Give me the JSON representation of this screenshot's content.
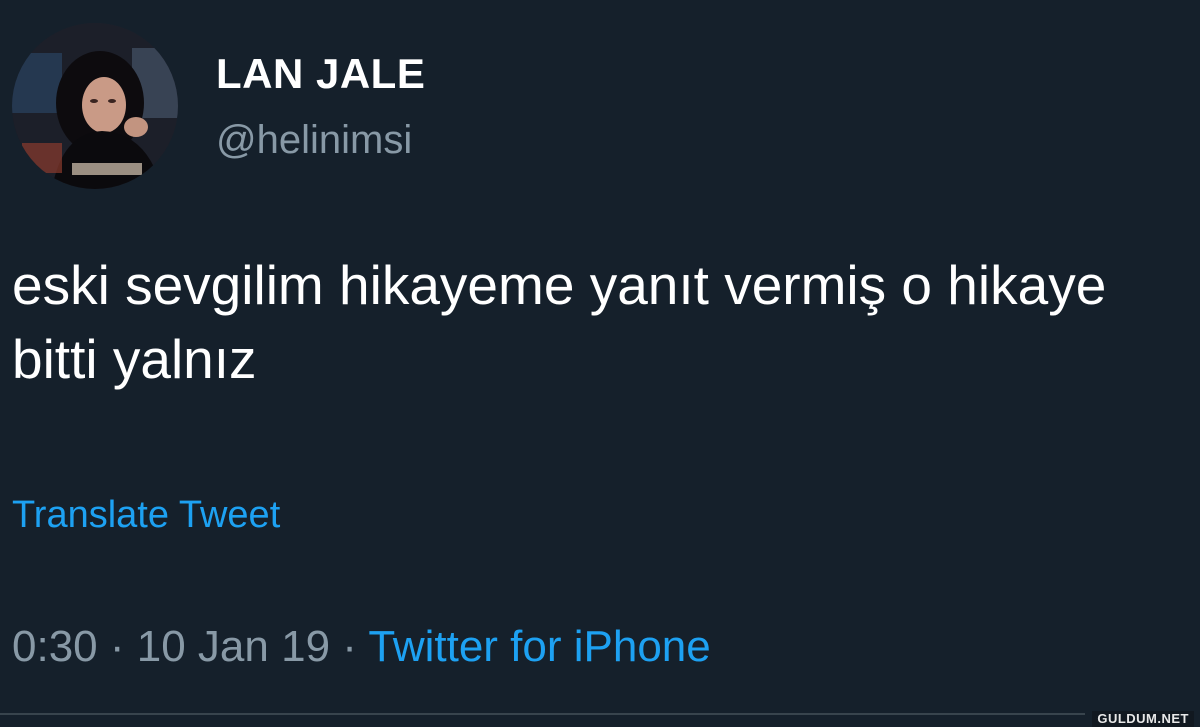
{
  "tweet": {
    "display_name": "LAN JALE",
    "handle": "@helinimsi",
    "text": "eski sevgilim hikayeme yanıt vermiş o hikaye bitti yalnız",
    "translate_label": "Translate Tweet",
    "time": "0:30",
    "separator": "·",
    "date": "10 Jan 19",
    "source": "Twitter for iPhone"
  },
  "watermark": "GULDUM.NET",
  "colors": {
    "background": "#15202b",
    "text_primary": "#ffffff",
    "text_secondary": "#8899a6",
    "link": "#1da1f2"
  }
}
